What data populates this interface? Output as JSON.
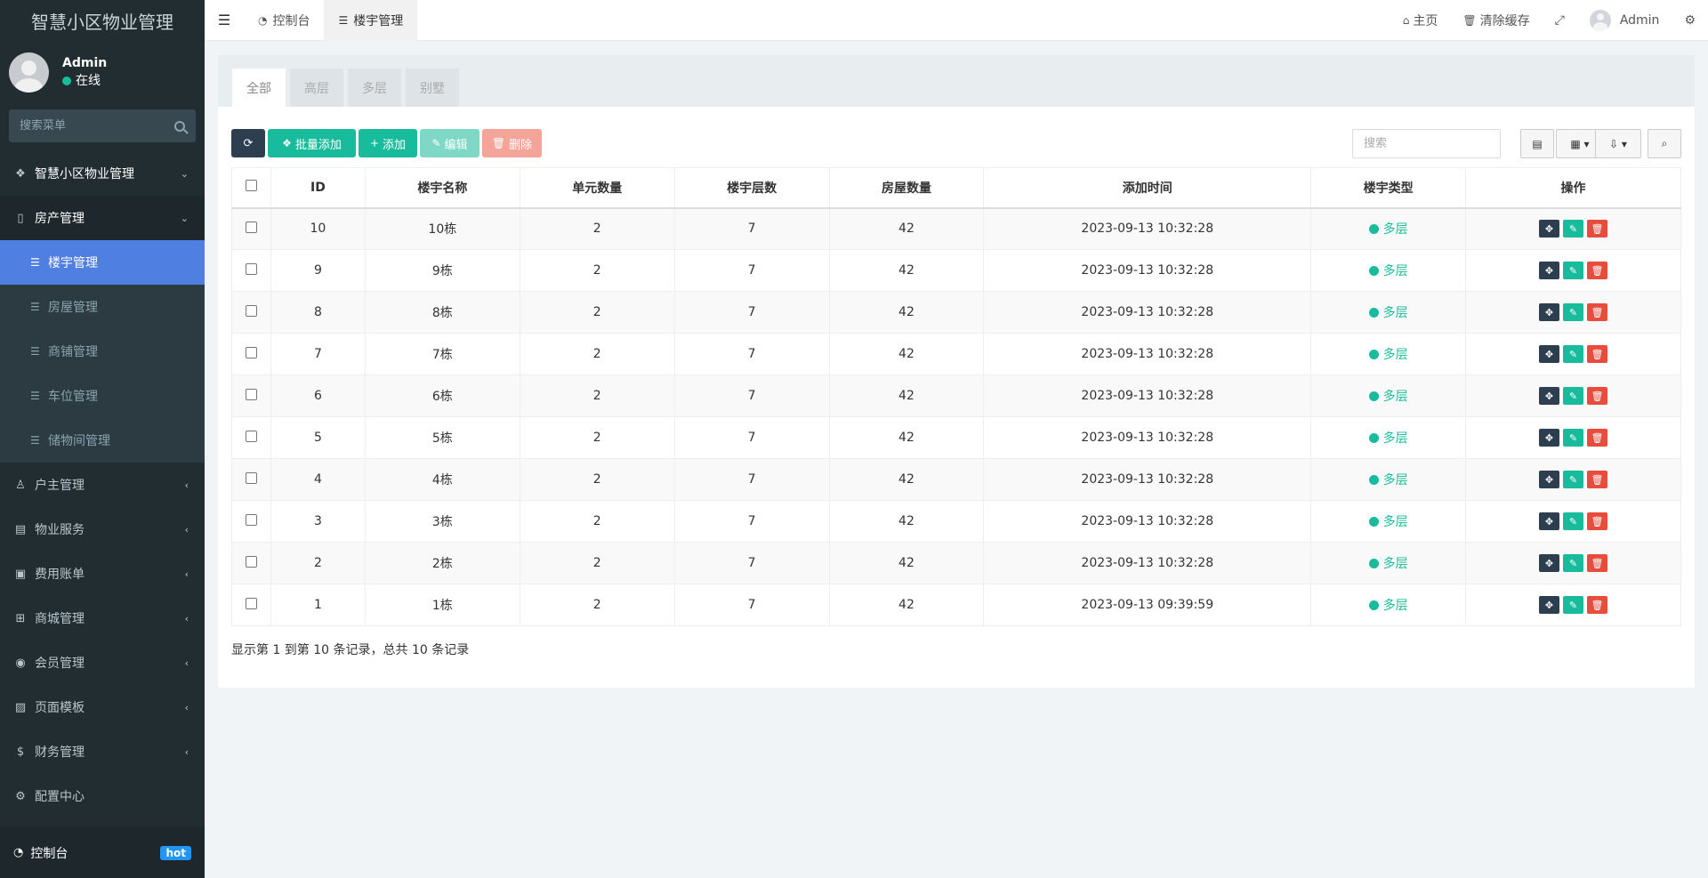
{
  "app": {
    "brand": "智慧小区物业管理"
  },
  "user": {
    "name": "Admin",
    "status": "在线"
  },
  "sidebar": {
    "search_placeholder": "搜索菜单",
    "top_item": {
      "label": "智慧小区物业管理",
      "icon": "cubes-icon"
    },
    "parent_item": {
      "label": "房产管理",
      "icon": "building-icon"
    },
    "sub_items": [
      {
        "label": "楼宇管理",
        "active": true
      },
      {
        "label": "房屋管理",
        "active": false
      },
      {
        "label": "商铺管理",
        "active": false
      },
      {
        "label": "车位管理",
        "active": false
      },
      {
        "label": "储物间管理",
        "active": false
      }
    ],
    "items": [
      {
        "label": "户主管理",
        "icon": "user-icon"
      },
      {
        "label": "物业服务",
        "icon": "server-icon"
      },
      {
        "label": "费用账单",
        "icon": "bill-icon"
      },
      {
        "label": "商城管理",
        "icon": "basket-icon"
      },
      {
        "label": "会员管理",
        "icon": "user-circle-icon"
      },
      {
        "label": "页面模板",
        "icon": "picture-icon"
      },
      {
        "label": "财务管理",
        "icon": "dollar-icon"
      },
      {
        "label": "配置中心",
        "icon": "gear-icon"
      }
    ],
    "footer": {
      "label": "控制台",
      "badge": "hot"
    }
  },
  "header": {
    "tabs": [
      {
        "label": "控制台",
        "icon": "dashboard-icon"
      },
      {
        "label": "楼宇管理",
        "icon": "list-icon"
      }
    ],
    "home": "主页",
    "clear_cache": "清除缓存",
    "user": "Admin"
  },
  "panel": {
    "tabs": [
      "全部",
      "高层",
      "多层",
      "别墅"
    ],
    "toolbar": {
      "batch_add": "批量添加",
      "add": "添加",
      "edit": "编辑",
      "delete": "删除",
      "search_placeholder": "搜索"
    },
    "columns": [
      "ID",
      "楼宇名称",
      "单元数量",
      "楼宇层数",
      "房屋数量",
      "添加时间",
      "楼宇类型",
      "操作"
    ],
    "rows": [
      {
        "id": "10",
        "name": "10栋",
        "units": "2",
        "floors": "7",
        "rooms": "42",
        "time": "2023-09-13 10:32:28",
        "type": "多层"
      },
      {
        "id": "9",
        "name": "9栋",
        "units": "2",
        "floors": "7",
        "rooms": "42",
        "time": "2023-09-13 10:32:28",
        "type": "多层"
      },
      {
        "id": "8",
        "name": "8栋",
        "units": "2",
        "floors": "7",
        "rooms": "42",
        "time": "2023-09-13 10:32:28",
        "type": "多层"
      },
      {
        "id": "7",
        "name": "7栋",
        "units": "2",
        "floors": "7",
        "rooms": "42",
        "time": "2023-09-13 10:32:28",
        "type": "多层"
      },
      {
        "id": "6",
        "name": "6栋",
        "units": "2",
        "floors": "7",
        "rooms": "42",
        "time": "2023-09-13 10:32:28",
        "type": "多层"
      },
      {
        "id": "5",
        "name": "5栋",
        "units": "2",
        "floors": "7",
        "rooms": "42",
        "time": "2023-09-13 10:32:28",
        "type": "多层"
      },
      {
        "id": "4",
        "name": "4栋",
        "units": "2",
        "floors": "7",
        "rooms": "42",
        "time": "2023-09-13 10:32:28",
        "type": "多层"
      },
      {
        "id": "3",
        "name": "3栋",
        "units": "2",
        "floors": "7",
        "rooms": "42",
        "time": "2023-09-13 10:32:28",
        "type": "多层"
      },
      {
        "id": "2",
        "name": "2栋",
        "units": "2",
        "floors": "7",
        "rooms": "42",
        "time": "2023-09-13 10:32:28",
        "type": "多层"
      },
      {
        "id": "1",
        "name": "1栋",
        "units": "2",
        "floors": "7",
        "rooms": "42",
        "time": "2023-09-13 09:39:59",
        "type": "多层"
      }
    ],
    "pager_info": "显示第 1 到第 10 条记录，总共 10 条记录"
  },
  "colors": {
    "sidebar_bg": "#222d32",
    "active_menu": "#4f7fe0",
    "primary_green": "#18bc9c",
    "danger": "#e74c3c",
    "dark": "#2c3e50"
  }
}
